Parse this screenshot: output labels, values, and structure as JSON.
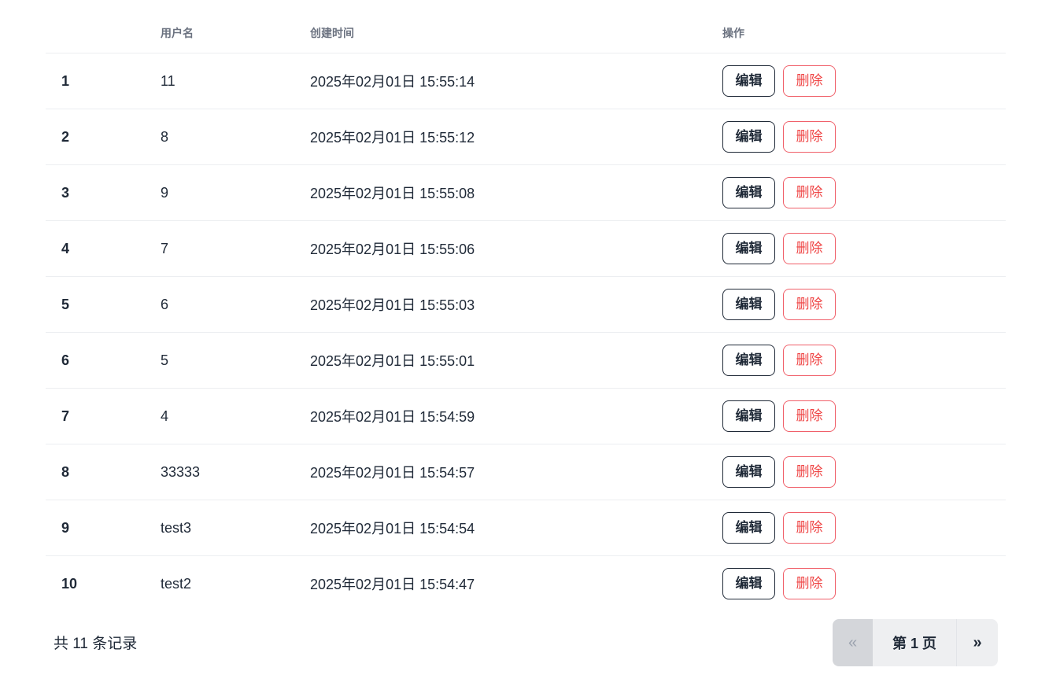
{
  "table": {
    "headers": {
      "index": "",
      "username": "用户名",
      "created_at": "创建时间",
      "actions": "操作"
    },
    "rows": [
      {
        "index": "1",
        "username": "11",
        "created_at": "2025年02月01日 15:55:14"
      },
      {
        "index": "2",
        "username": "8",
        "created_at": "2025年02月01日 15:55:12"
      },
      {
        "index": "3",
        "username": "9",
        "created_at": "2025年02月01日 15:55:08"
      },
      {
        "index": "4",
        "username": "7",
        "created_at": "2025年02月01日 15:55:06"
      },
      {
        "index": "5",
        "username": "6",
        "created_at": "2025年02月01日 15:55:03"
      },
      {
        "index": "6",
        "username": "5",
        "created_at": "2025年02月01日 15:55:01"
      },
      {
        "index": "7",
        "username": "4",
        "created_at": "2025年02月01日 15:54:59"
      },
      {
        "index": "8",
        "username": "33333",
        "created_at": "2025年02月01日 15:54:57"
      },
      {
        "index": "9",
        "username": "test3",
        "created_at": "2025年02月01日 15:54:54"
      },
      {
        "index": "10",
        "username": "test2",
        "created_at": "2025年02月01日 15:54:47"
      }
    ],
    "edit_label": "编辑",
    "delete_label": "删除"
  },
  "footer": {
    "total_text": "共 11 条记录",
    "pager": {
      "prev": "«",
      "current": "第 1 页",
      "next": "»"
    }
  },
  "colors": {
    "text": "#1f2937",
    "header_text": "#6b7280",
    "danger": "#ef4444",
    "pager_bg": "#eeeff1",
    "pager_disabled_bg": "#d4d6da"
  }
}
